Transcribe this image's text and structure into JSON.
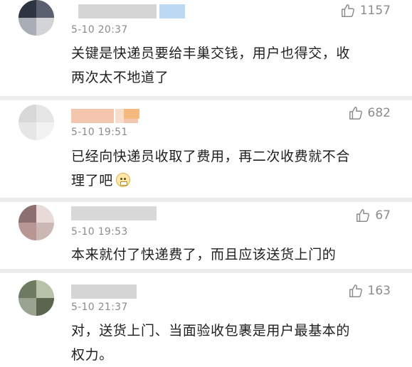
{
  "comments": [
    {
      "time": "5-10 20:37",
      "likes": "1157",
      "text_lines": [
        "关键是快递员要给丰巢交钱，用户也得交，收",
        "两次太不地道了"
      ]
    },
    {
      "time": "5-10 19:51",
      "likes": "682",
      "text_lines": [
        "已经向快递员收取了费用，再二次收费就不合",
        "理了吧"
      ]
    },
    {
      "time": "5-10 19:53",
      "likes": "67",
      "text_lines": [
        "本来就付了快递费了，而且应该送货上门的"
      ]
    },
    {
      "time": "5-10 21:37",
      "likes": "163",
      "text_lines": [
        "对，送货上门、当面验收包裹是用户最基本的",
        "权力。"
      ]
    }
  ],
  "icons": {
    "like": "thumbs-up-icon",
    "emoji": "grin-emoji-icon"
  },
  "colors": {
    "meta": "#8c8c8c",
    "text": "#1f1f1f",
    "divider": "#ececec"
  }
}
